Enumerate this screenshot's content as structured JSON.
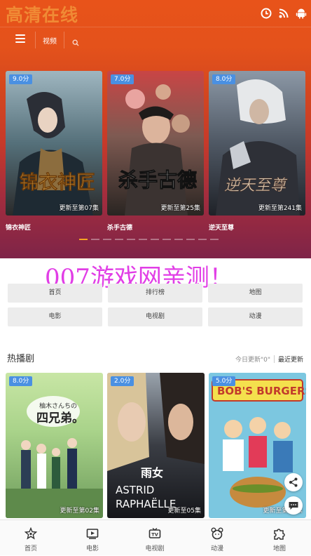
{
  "app": {
    "logo": "高清在线"
  },
  "top_icons": [
    "clock-icon",
    "rss-icon",
    "android-icon"
  ],
  "nav": {
    "tab": "视频",
    "menu_icon": "menu-icon",
    "search_icon": "search-icon"
  },
  "carousel": [
    {
      "score": "9.0分",
      "update": "更新至第07集",
      "title": "锦衣神匠"
    },
    {
      "score": "7.0分",
      "update": "更新至第25集",
      "title": "杀手古德"
    },
    {
      "score": "8.0分",
      "update": "更新至第241集",
      "title": "逆天至尊"
    }
  ],
  "carousel_dots": {
    "count": 12,
    "active": 0
  },
  "watermark": "007游戏网亲测！",
  "categories": [
    {
      "label": "首页"
    },
    {
      "label": "排行榜"
    },
    {
      "label": "地图"
    },
    {
      "label": "电影"
    },
    {
      "label": "电视剧"
    },
    {
      "label": "动漫"
    }
  ],
  "section": {
    "title": "热播剧",
    "tab_today": "今日更新\"0\"",
    "tab_recent": "最近更新"
  },
  "posters": [
    {
      "score": "8.0分",
      "update": "更新至第02集"
    },
    {
      "score": "2.0分",
      "update": "更新至05集"
    },
    {
      "score": "5.0分",
      "update": "更新至第02集"
    }
  ],
  "bottom_nav": [
    {
      "label": "首页",
      "icon": "home-icon"
    },
    {
      "label": "电影",
      "icon": "movie-icon"
    },
    {
      "label": "电视剧",
      "icon": "tv-icon"
    },
    {
      "label": "动漫",
      "icon": "anime-icon"
    },
    {
      "label": "地图",
      "icon": "map-icon"
    }
  ],
  "colors": {
    "accent": "#f6a623",
    "score_badge": "#4a90e2",
    "watermark": "#e13ee6",
    "hero_top": "#e8531a"
  }
}
